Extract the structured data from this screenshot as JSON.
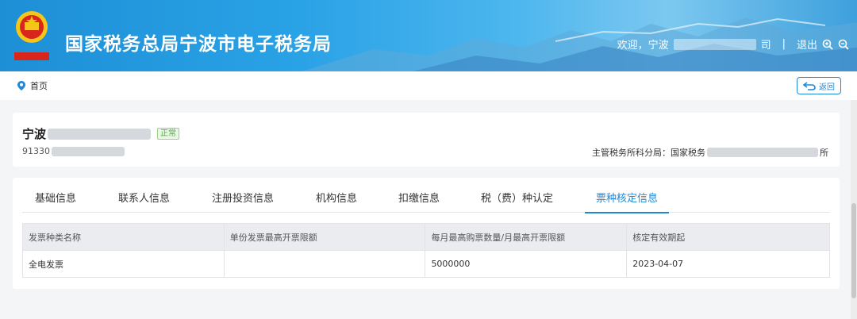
{
  "header": {
    "title": "国家税务总局宁波市电子税务局",
    "welcome": "欢迎，宁波",
    "welcome_tail": "司",
    "separator": "|",
    "logout": "退出",
    "emblem_caption": "中国税务",
    "zoom_in_icon": "zoom-in-icon",
    "zoom_out_icon": "zoom-out-icon"
  },
  "nav": {
    "home_label": "首页",
    "home_icon": "location-pin-icon",
    "back_label": "返回",
    "back_icon": "return-arrow-icon"
  },
  "company": {
    "name_prefix": "宁波",
    "status": "正常",
    "id_prefix": "91330",
    "tax_office_label": "主管税务所科分局：国家税务",
    "tax_office_tail": "所"
  },
  "tabs": [
    {
      "label": "基础信息",
      "active": false
    },
    {
      "label": "联系人信息",
      "active": false
    },
    {
      "label": "注册投资信息",
      "active": false
    },
    {
      "label": "机构信息",
      "active": false
    },
    {
      "label": "扣缴信息",
      "active": false
    },
    {
      "label": "税（费）种认定",
      "active": false
    },
    {
      "label": "票种核定信息",
      "active": true
    }
  ],
  "table": {
    "headers": [
      "发票种类名称",
      "单份发票最高开票限额",
      "每月最高购票数量/月最高开票限额",
      "核定有效期起"
    ],
    "rows": [
      [
        "全电发票",
        "",
        "5000000",
        "2023-04-07"
      ]
    ]
  },
  "colors": {
    "accent": "#1e88d8",
    "header_blue": "#2aa2e6",
    "status_green": "#52a845"
  }
}
